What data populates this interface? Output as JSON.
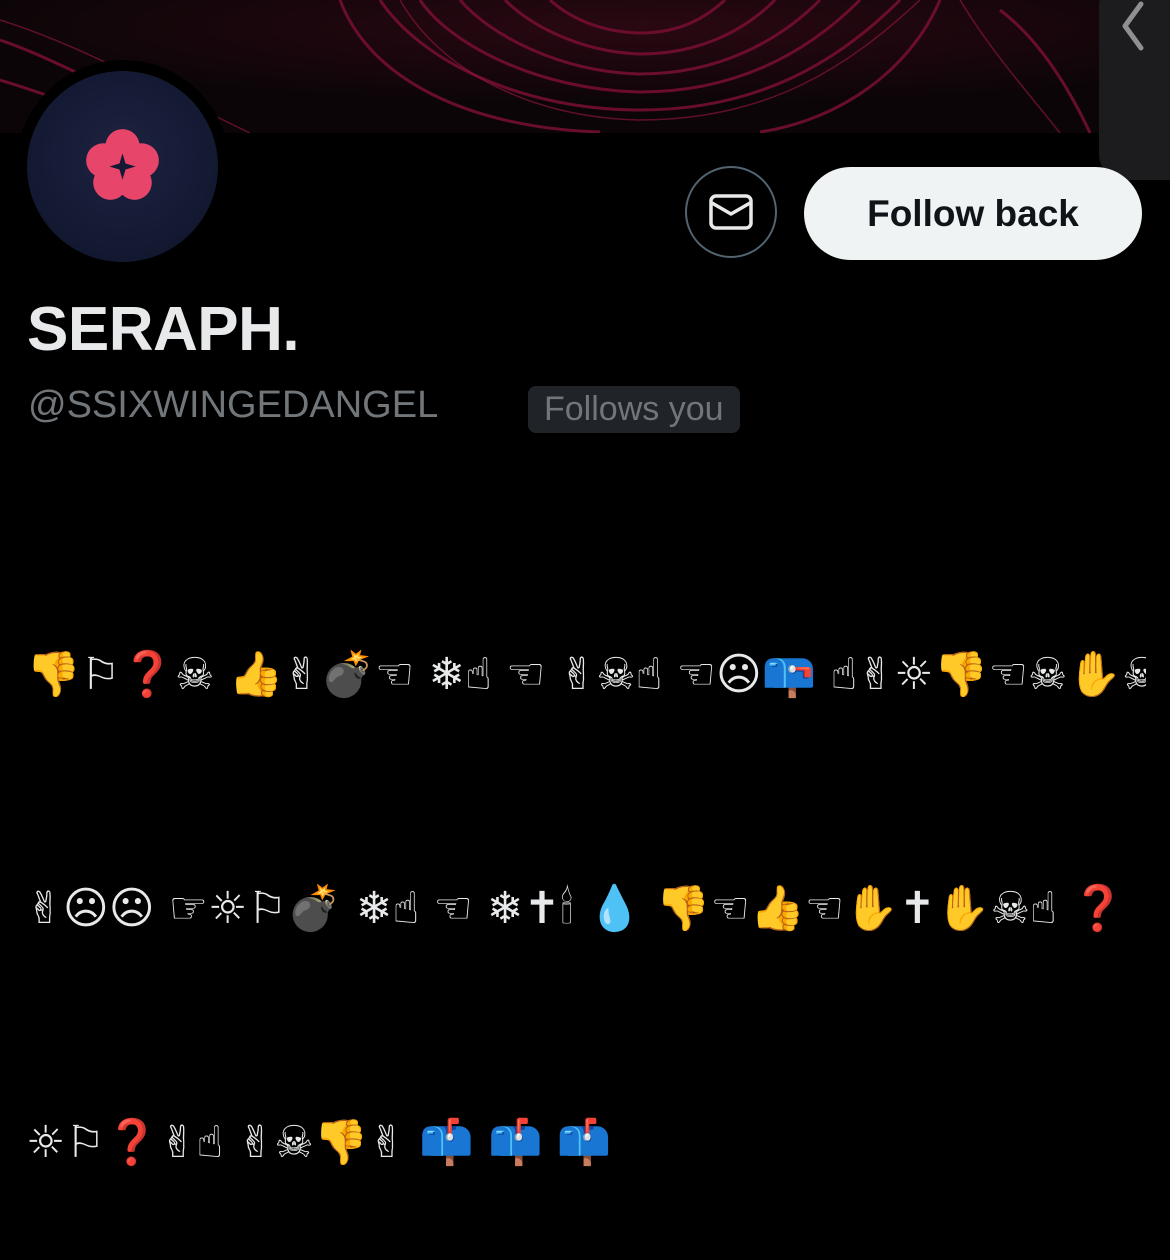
{
  "banner": {
    "accent_color": "#7a0f33",
    "base_color": "#0b0507"
  },
  "profile": {
    "display_name": "SERAPH.",
    "handle": "@SSIXWINGEDANGEL",
    "follows_you_label": "Follows you",
    "avatar_icon": "pink-flower-star-icon",
    "avatar_color": "#e8456a"
  },
  "actions": {
    "message_icon": "mail-icon",
    "follow_label": "Follow back"
  },
  "side_panel": {
    "icon": "chevron-left-icon"
  },
  "bio": {
    "lines": [
      "👎⚐❓☠ 👍✌💣☜ ❄☝ ☜ ✌☠☝ ☜☹📪 ☝✌☼👎☜☠✋☠☝",
      "✌☹☹ ☞☼⚐💣 ❄☝ ☜ ❄✝🕯 💧 👎☜👍☜✋✝✋☠☝ ❓",
      "☼⚐❓✌☝ ✌☠👎✌ 📫 📫 📫"
    ]
  }
}
